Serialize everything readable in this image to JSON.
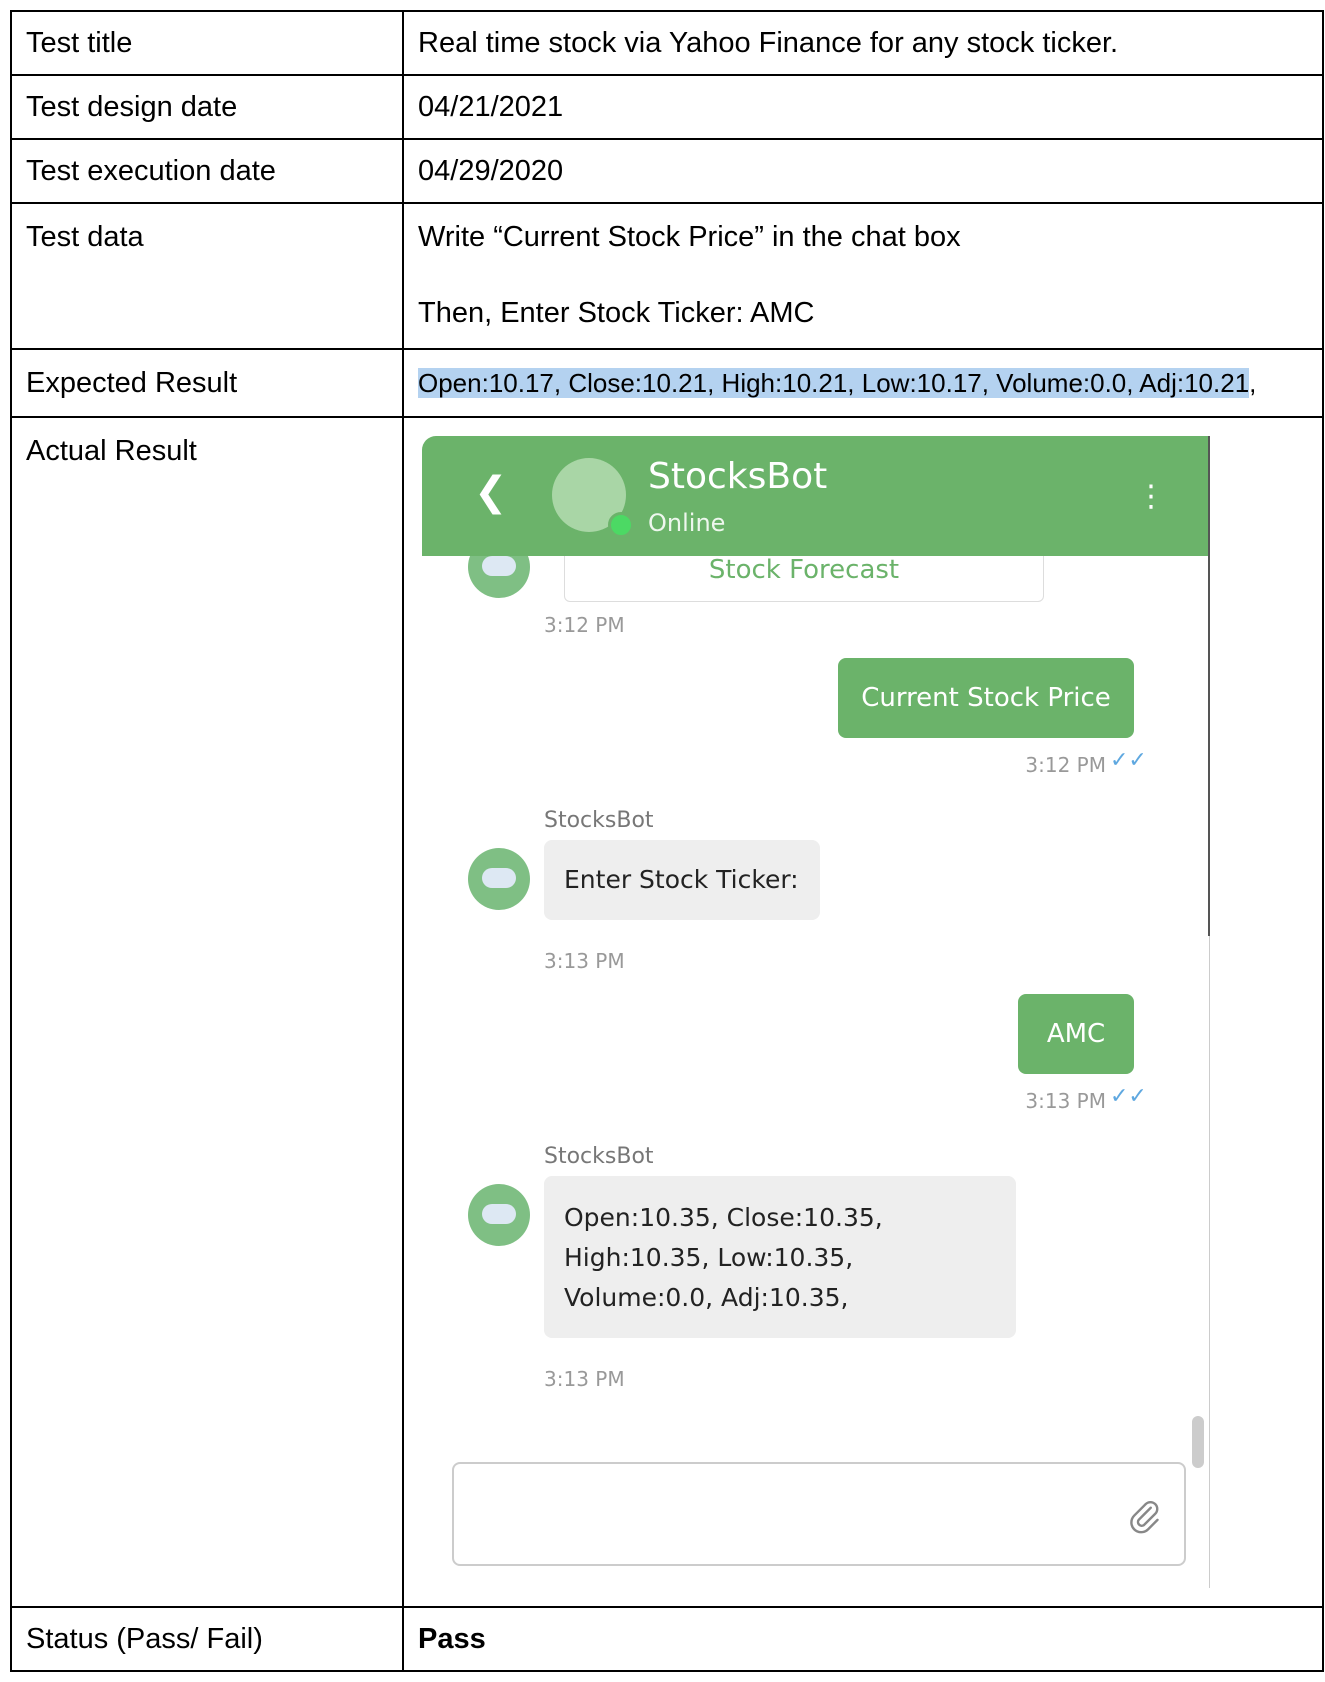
{
  "rows": {
    "title": {
      "label": "Test title",
      "value": "Real time stock via Yahoo Finance for any stock ticker."
    },
    "design_date": {
      "label": "Test design date",
      "value": "04/21/2021"
    },
    "execution_date": {
      "label": "Test execution date",
      "value": "04/29/2020"
    },
    "test_data": {
      "label": "Test data",
      "line1": "Write “Current Stock Price” in the chat box",
      "line2": "Then, Enter Stock Ticker: AMC"
    },
    "expected": {
      "label": "Expected Result",
      "value": "Open:10.17, Close:10.21, High:10.21, Low:10.17, Volume:0.0, Adj:10.21",
      "trailing": ","
    },
    "actual": {
      "label": "Actual Result"
    },
    "status": {
      "label": "Status (Pass/ Fail)",
      "value": "Pass"
    }
  },
  "chat": {
    "header": {
      "name": "StocksBot",
      "status": "Online",
      "back_icon": "chevron-left-icon",
      "menu_icon": "kebab-menu-icon"
    },
    "accent_color": "#6bb36a",
    "forecast_label": "Stock Forecast",
    "messages": [
      {
        "time": "3:12 PM"
      },
      {
        "from": "user",
        "text": "Current Stock Price",
        "time": "3:12 PM"
      },
      {
        "from": "bot",
        "sender": "StocksBot",
        "text": "Enter Stock Ticker:",
        "time": "3:13 PM"
      },
      {
        "from": "user",
        "text": "AMC",
        "time": "3:13 PM"
      },
      {
        "from": "bot",
        "sender": "StocksBot",
        "lines": [
          "Open:10.35, Close:10.35,",
          "High:10.35, Low:10.35,",
          "Volume:0.0, Adj:10.35,"
        ],
        "time": "3:13 PM"
      }
    ],
    "read_icon": "double-check-icon",
    "attach_icon": "paperclip-icon"
  }
}
